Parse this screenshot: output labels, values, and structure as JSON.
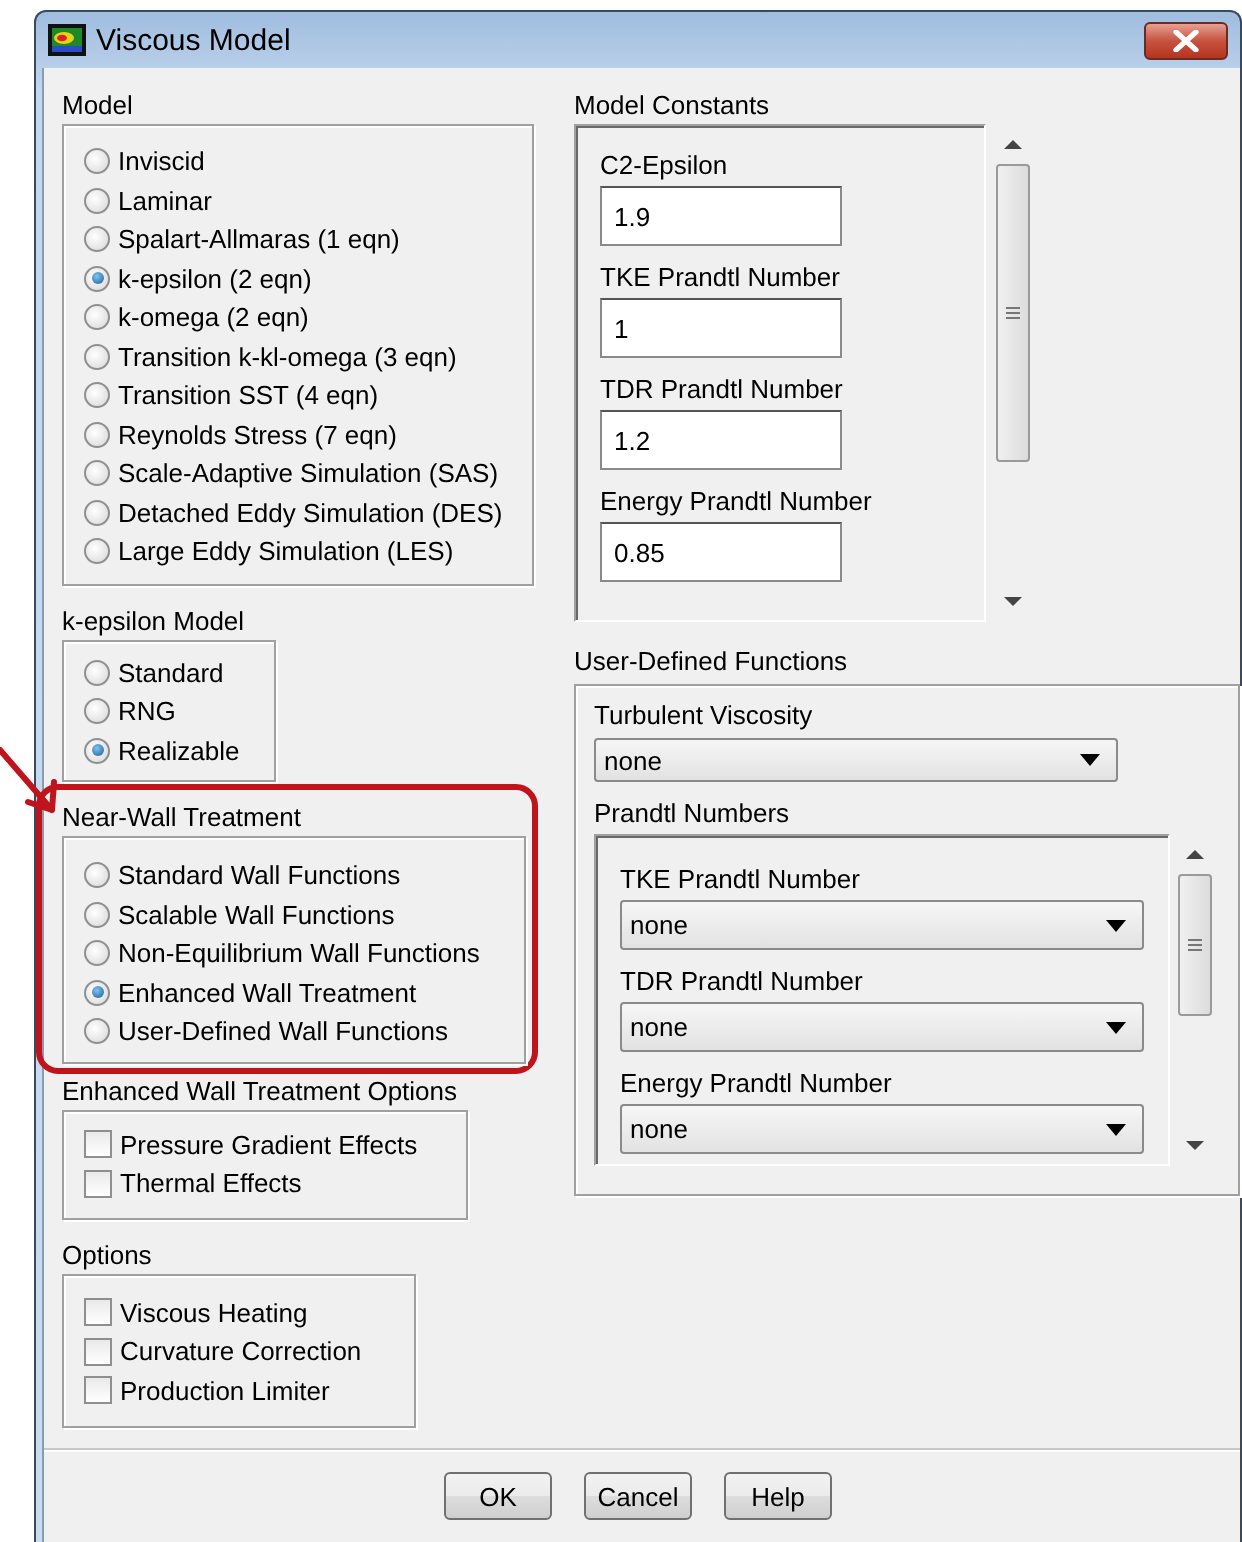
{
  "window": {
    "title": "Viscous Model"
  },
  "model": {
    "label": "Model",
    "options": [
      {
        "label": "Inviscid",
        "selected": false
      },
      {
        "label": "Laminar",
        "selected": false
      },
      {
        "label": "Spalart-Allmaras (1 eqn)",
        "selected": false
      },
      {
        "label": "k-epsilon (2 eqn)",
        "selected": true
      },
      {
        "label": "k-omega (2 eqn)",
        "selected": false
      },
      {
        "label": "Transition k-kl-omega (3 eqn)",
        "selected": false
      },
      {
        "label": "Transition SST (4 eqn)",
        "selected": false
      },
      {
        "label": "Reynolds Stress (7 eqn)",
        "selected": false
      },
      {
        "label": "Scale-Adaptive Simulation (SAS)",
        "selected": false
      },
      {
        "label": "Detached Eddy Simulation (DES)",
        "selected": false
      },
      {
        "label": "Large Eddy Simulation (LES)",
        "selected": false
      }
    ]
  },
  "k_epsilon_model": {
    "label": "k-epsilon Model",
    "options": [
      {
        "label": "Standard",
        "selected": false
      },
      {
        "label": "RNG",
        "selected": false
      },
      {
        "label": "Realizable",
        "selected": true
      }
    ]
  },
  "near_wall_treatment": {
    "label": "Near-Wall Treatment",
    "highlighted": true,
    "options": [
      {
        "label": "Standard Wall Functions",
        "selected": false
      },
      {
        "label": "Scalable Wall Functions",
        "selected": false
      },
      {
        "label": "Non-Equilibrium Wall Functions",
        "selected": false
      },
      {
        "label": "Enhanced Wall Treatment",
        "selected": true
      },
      {
        "label": "User-Defined Wall Functions",
        "selected": false
      }
    ]
  },
  "enhanced_wall_treatment_options": {
    "label": "Enhanced Wall Treatment Options",
    "options": [
      {
        "label": "Pressure Gradient Effects",
        "checked": false
      },
      {
        "label": "Thermal Effects",
        "checked": false
      }
    ]
  },
  "options": {
    "label": "Options",
    "options": [
      {
        "label": "Viscous Heating",
        "checked": false
      },
      {
        "label": "Curvature Correction",
        "checked": false
      },
      {
        "label": "Production Limiter",
        "checked": false
      }
    ]
  },
  "model_constants": {
    "label": "Model Constants",
    "fields": [
      {
        "label": "C2-Epsilon",
        "value": "1.9"
      },
      {
        "label": "TKE Prandtl Number",
        "value": "1"
      },
      {
        "label": "TDR Prandtl Number",
        "value": "1.2"
      },
      {
        "label": "Energy Prandtl Number",
        "value": "0.85"
      }
    ]
  },
  "user_defined_functions": {
    "label": "User-Defined Functions",
    "turbulent_viscosity": {
      "label": "Turbulent Viscosity",
      "value": "none"
    },
    "prandtl_numbers": {
      "label": "Prandtl Numbers",
      "fields": [
        {
          "label": "TKE Prandtl Number",
          "value": "none"
        },
        {
          "label": "TDR Prandtl Number",
          "value": "none"
        },
        {
          "label": "Energy Prandtl Number",
          "value": "none"
        }
      ]
    }
  },
  "buttons": [
    {
      "label": "OK"
    },
    {
      "label": "Cancel"
    },
    {
      "label": "Help"
    }
  ]
}
